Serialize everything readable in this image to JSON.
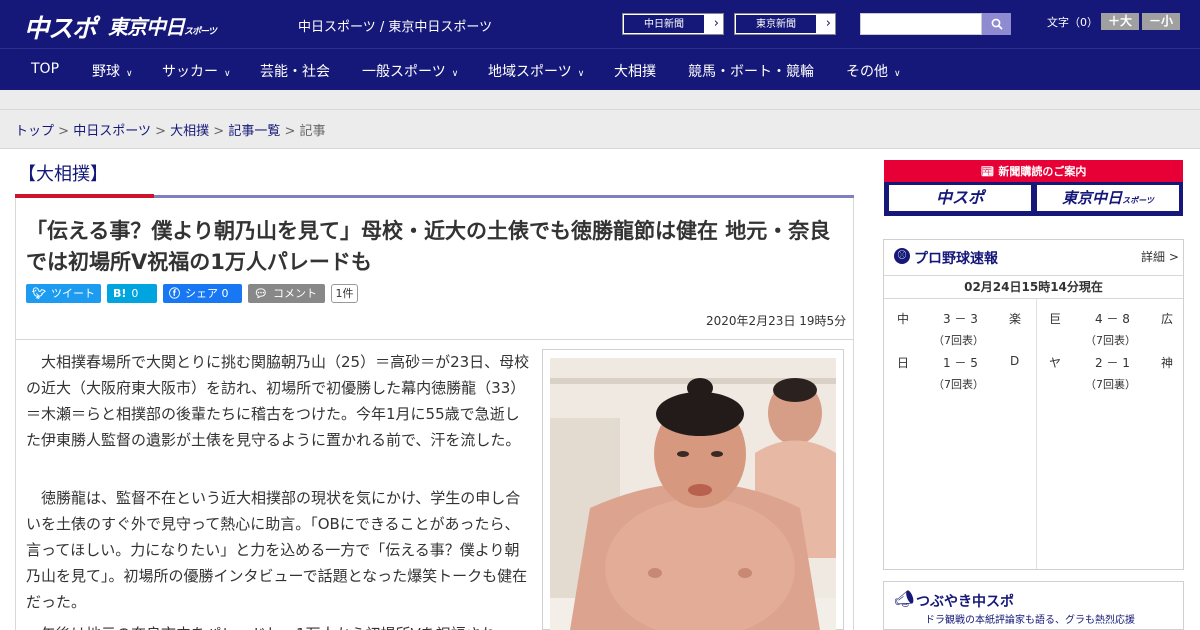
{
  "header": {
    "logo_main": "中スポ",
    "logo_tokyo": "東京中日",
    "logo_tokyo_sub": "スポーツ",
    "site_caption": "中日スポーツ / 東京中日スポーツ",
    "paper_links": [
      "中日新聞",
      "東京新聞"
    ],
    "search_placeholder": "",
    "search_icon": "search-icon",
    "font_size_label": "文字（0）",
    "font_plus": "＋大",
    "font_minus": "－小"
  },
  "nav": [
    {
      "label": "TOP",
      "dropdown": false
    },
    {
      "label": "野球",
      "dropdown": true
    },
    {
      "label": "サッカー",
      "dropdown": true
    },
    {
      "label": "芸能・社会",
      "dropdown": false
    },
    {
      "label": "一般スポーツ",
      "dropdown": true
    },
    {
      "label": "地域スポーツ",
      "dropdown": true
    },
    {
      "label": "大相撲",
      "dropdown": false
    },
    {
      "label": "競馬・ボート・競輪",
      "dropdown": false
    },
    {
      "label": "その他",
      "dropdown": true
    }
  ],
  "breadcrumb": {
    "links": [
      "トップ",
      "中日スポーツ",
      "大相撲",
      "記事一覧"
    ],
    "current": "記事",
    "separator": ">"
  },
  "article": {
    "category": "【大相撲】",
    "headline": "「伝える事？僕より朝乃山を見て」母校・近大の土俵でも徳勝龍節は健在 地元・奈良では初場所V祝福の1万人パレードも",
    "share": {
      "tweet": "ツイート",
      "hatena_count": "0",
      "facebook": "シェア 0",
      "comment": "コメント",
      "comment_count": "1件"
    },
    "date": "2020年2月23日 19時5分",
    "paragraphs": [
      "大相撲春場所で大関とりに挑む関脇朝乃山（25）＝高砂＝が23日、母校の近大（大阪府東大阪市）を訪れ、初場所で初優勝した幕内徳勝龍（33）＝木瀬＝らと相撲部の後輩たちに稽古をつけた。今年1月に55歳で急逝した伊東勝人監督の遺影が土俵を見守るように置かれる前で、汗を流した。",
      "徳勝龍は、監督不在という近大相撲部の現状を気にかけ、学生の申し合いを土俵のすぐ外で見守って熱心に助言。「OBにできることがあったら、言ってほしい。力になりたい」と力を込める一方で「伝える事？僕より朝乃山を見て」。初場所の優勝インタビューで話題となった爆笑トークも健在だった。",
      "午後は地元の奈良市内をパレードし、1万人から初場所Vを祝福され"
    ]
  },
  "sidebar": {
    "promo_title": "新聞購読のご案内",
    "promo_logos": [
      "中スポ",
      "東京中日"
    ],
    "promo_logo_sub": "スポーツ",
    "baseball": {
      "title": "プロ野球速報",
      "more": "詳細 >",
      "updated": "02月24日15時14分現在",
      "games": [
        {
          "home": "中",
          "score": "3 － 3",
          "away": "楽",
          "note": "（7回表）"
        },
        {
          "home": "巨",
          "score": "4 － 8",
          "away": "広",
          "note": "（7回表）"
        },
        {
          "home": "日",
          "score": "1 － 5",
          "away": "D",
          "note": "（7回表）"
        },
        {
          "home": "ヤ",
          "score": "2 － 1",
          "away": "神",
          "note": "（7回裏）"
        }
      ]
    },
    "tsubuyaki": {
      "title": "つぶやき中スポ",
      "subtitle": "ドラ観戦の本紙評論家も語る、グラも熱烈応援"
    }
  }
}
